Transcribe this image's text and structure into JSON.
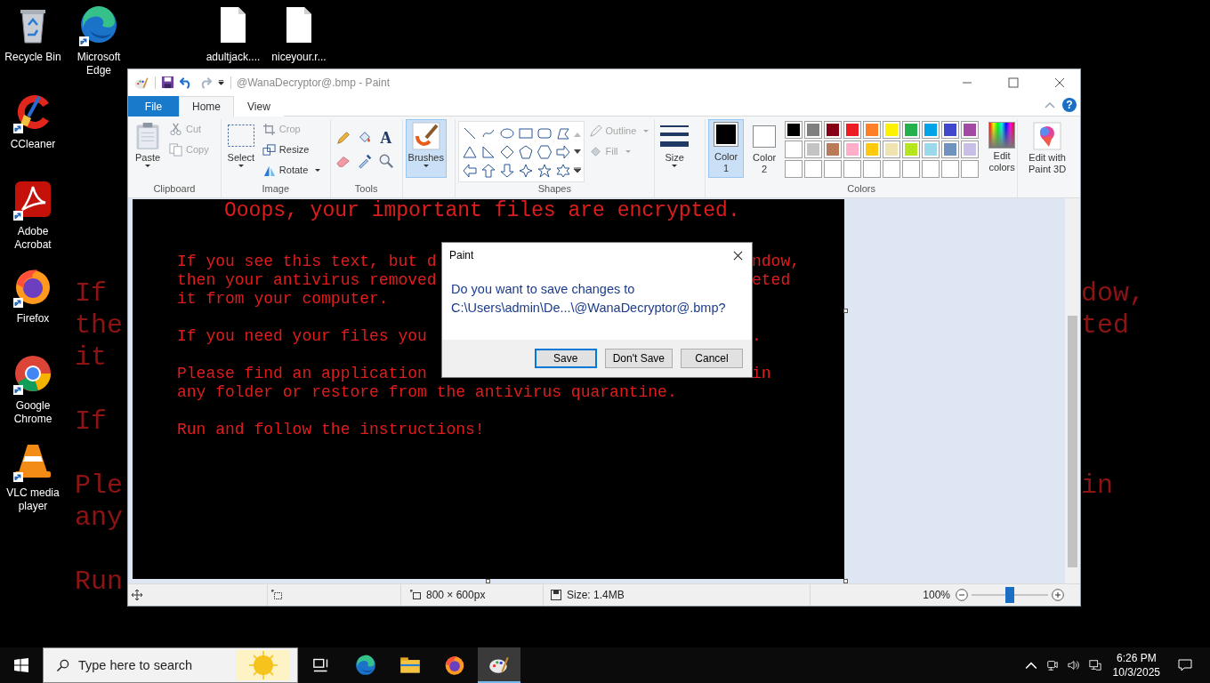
{
  "desktop": {
    "wallpaper_text": [
      [
        {
          "left": "If",
          "right": "dow,"
        },
        {
          "left": "the",
          "right": "ted"
        },
        {
          "left": "it"
        }
      ],
      [
        {
          "left": "If"
        }
      ],
      [
        {
          "left": "Ple",
          "right": "in"
        },
        {
          "left": "any"
        }
      ],
      [
        {
          "left": "Run"
        }
      ]
    ],
    "icons": [
      {
        "label": "Recycle Bin",
        "kind": "recycle-bin",
        "shortcut": false
      },
      {
        "label": "CCleaner",
        "kind": "ccleaner",
        "shortcut": true
      },
      {
        "label": "Adobe Acrobat",
        "kind": "acrobat",
        "shortcut": true
      },
      {
        "label": "Firefox",
        "kind": "firefox",
        "shortcut": true
      },
      {
        "label": "Google Chrome",
        "kind": "chrome",
        "shortcut": true
      },
      {
        "label": "VLC media player",
        "kind": "vlc",
        "shortcut": true
      },
      {
        "label": "Microsoft Edge",
        "kind": "edge",
        "shortcut": true
      }
    ],
    "files": [
      {
        "label": "adultjack...."
      },
      {
        "label": "niceyour.r..."
      }
    ]
  },
  "window": {
    "title": "@WanaDecryptor@.bmp - Paint",
    "tabs": [
      {
        "label": "File",
        "kind": "file",
        "selected": false
      },
      {
        "label": "Home",
        "kind": "tab",
        "selected": true
      },
      {
        "label": "View",
        "kind": "tab",
        "selected": false
      }
    ],
    "help": "?",
    "ribbon": {
      "clipboard": {
        "label": "Clipboard",
        "paste": "Paste",
        "cut": {
          "label": "Cut",
          "disabled": true
        },
        "copy": {
          "label": "Copy",
          "disabled": true
        }
      },
      "image": {
        "label": "Image",
        "select": "Select",
        "crop": {
          "label": "Crop",
          "disabled": true
        },
        "resize": {
          "label": "Resize",
          "disabled": false
        },
        "rotate": {
          "label": "Rotate",
          "disabled": false
        }
      },
      "tools": {
        "label": "Tools",
        "text_tool": "A"
      },
      "brushes": {
        "label": "Brushes",
        "selected": true
      },
      "shapes": {
        "label": "Shapes",
        "outline": {
          "label": "Outline",
          "disabled": true
        },
        "fill": {
          "label": "Fill",
          "disabled": true
        }
      },
      "size": {
        "label": "Size"
      },
      "colors": {
        "label": "Colors",
        "color1": {
          "label": "Color 1",
          "color": "#000000",
          "selected": true
        },
        "color2": {
          "label": "Color 2",
          "color": "#ffffff",
          "selected": false
        },
        "palette": [
          [
            {
              "kind": "swatch",
              "color": "#000000"
            },
            {
              "kind": "swatch",
              "color": "#7f7f7f"
            },
            {
              "kind": "swatch",
              "color": "#880015"
            },
            {
              "kind": "swatch",
              "color": "#ed1c24"
            },
            {
              "kind": "swatch",
              "color": "#ff7f27"
            },
            {
              "kind": "swatch",
              "color": "#fff200"
            },
            {
              "kind": "swatch",
              "color": "#22b14c"
            },
            {
              "kind": "swatch",
              "color": "#00a2e8"
            },
            {
              "kind": "swatch",
              "color": "#3f48cc"
            },
            {
              "kind": "swatch",
              "color": "#a349a4"
            }
          ],
          [
            {
              "kind": "swatch",
              "color": "#ffffff"
            },
            {
              "kind": "swatch",
              "color": "#c3c3c3"
            },
            {
              "kind": "swatch",
              "color": "#b97a57"
            },
            {
              "kind": "swatch",
              "color": "#ffaec9"
            },
            {
              "kind": "swatch",
              "color": "#ffc90e"
            },
            {
              "kind": "swatch",
              "color": "#efe4b0"
            },
            {
              "kind": "swatch",
              "color": "#b5e61d"
            },
            {
              "kind": "swatch",
              "color": "#99d9ea"
            },
            {
              "kind": "swatch",
              "color": "#7092be"
            },
            {
              "kind": "swatch",
              "color": "#c8bfe7"
            }
          ],
          [
            {
              "kind": "empty"
            },
            {
              "kind": "empty"
            },
            {
              "kind": "empty"
            },
            {
              "kind": "empty"
            },
            {
              "kind": "empty"
            },
            {
              "kind": "empty"
            },
            {
              "kind": "empty"
            },
            {
              "kind": "empty"
            },
            {
              "kind": "empty"
            },
            {
              "kind": "empty"
            }
          ]
        ],
        "edit_colors": "Edit colors"
      },
      "paint3d": "Edit with Paint 3D"
    },
    "canvas": {
      "heading": "Ooops, your important files are encrypted.",
      "paragraphs": [
        [
          {
            "left": "If you see this text, but d",
            "right": "ndow,"
          },
          {
            "left": "then your antivirus removed",
            "right": "eted"
          },
          {
            "left": "it from your computer."
          }
        ],
        [
          {
            "left": "If you need your files you",
            "right": "."
          }
        ],
        [
          {
            "left": "Please find an application",
            "right": "in"
          },
          {
            "left": "any folder or restore from the antivirus quarantine."
          }
        ],
        [
          {
            "left": "Run and follow the instructions!"
          }
        ]
      ]
    },
    "status_bar": {
      "dimensions": "800 × 600px",
      "size": "Size: 1.4MB",
      "zoom": "100%",
      "zoom_slider": {
        "level": 0.5
      }
    }
  },
  "dialog": {
    "title": "Paint",
    "message": [
      "Do you want to save changes to",
      "C:\\Users\\admin\\De...\\@WanaDecryptor@.bmp?"
    ],
    "buttons": [
      {
        "label": "Save",
        "default": true
      },
      {
        "label": "Don't Save",
        "default": false
      },
      {
        "label": "Cancel",
        "default": false
      }
    ]
  },
  "taskbar": {
    "search": {
      "placeholder": "Type here to search"
    },
    "apps": [
      {
        "kind": "task-view",
        "active": false
      },
      {
        "kind": "edge",
        "active": false
      },
      {
        "kind": "explorer",
        "active": false
      },
      {
        "kind": "firefox",
        "active": false
      },
      {
        "kind": "paint",
        "active": true
      }
    ],
    "time": "6:26 PM",
    "date": "10/3/2025"
  }
}
